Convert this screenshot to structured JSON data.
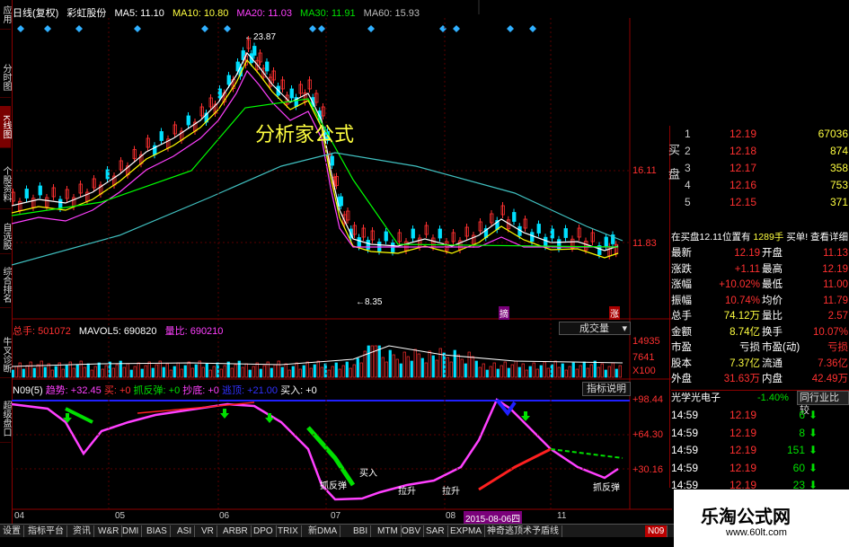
{
  "colors": {
    "up": "#ff3030",
    "down": "#00e0ff",
    "ma5": "#ffffff",
    "ma10": "#ffff00",
    "ma20": "#ff40ff",
    "ma30": "#00ff00",
    "ma60": "#c0c0c0",
    "trend_line": "#ff40ff",
    "blue_line": "#2020ff"
  },
  "sidebar": {
    "tabs": [
      "应用",
      "分时图",
      "K线图",
      "个股资料",
      "自选股",
      "综合排名",
      "牛叉诊断",
      "超级盘口"
    ]
  },
  "header": {
    "period": "日线(复权)",
    "stock_name": "彩虹股份",
    "ma5": "MA5: 11.10",
    "ma10": "MA10: 10.80",
    "ma20": "MA20: 11.03",
    "ma30": "MA30: 11.91",
    "ma60": "MA60: 15.93"
  },
  "price_chart": {
    "high_label": "23.87",
    "low_label": "8.35",
    "watermark": "分析家公式",
    "price_axis": [
      "16.11",
      "11.83"
    ],
    "tag_buy": "摘",
    "tag_sell": "涨"
  },
  "volume_panel": {
    "total": "总手: 501072",
    "mavol": "MAVOL5: 690820",
    "ratio": "量比: 690210",
    "mode": "成交量",
    "axis": [
      "14935",
      "7641",
      "X100"
    ]
  },
  "indicator_panel": {
    "name": "N09(5)",
    "trend": "趋势: +32.45",
    "buy1": "买: +0",
    "rebound": "抓反弹: +0",
    "bottom": "抄底: +0",
    "peak": "逃顶: +21.00",
    "buy2": "买入: +0",
    "help": "指标说明",
    "axis": [
      "+98.44",
      "+64.30",
      "+30.16"
    ],
    "labels": [
      "抓反弹",
      "买入",
      "拉升",
      "拉升",
      "抓反弹"
    ]
  },
  "x_axis": {
    "labels": [
      "04",
      "05",
      "06",
      "07",
      "08",
      "11"
    ],
    "date_highlight": "2015-08-06四"
  },
  "orderbook": {
    "side_label": "买盘",
    "rows": [
      {
        "level": "1",
        "price": "12.19",
        "vol": "67036"
      },
      {
        "level": "2",
        "price": "12.18",
        "vol": "874"
      },
      {
        "level": "3",
        "price": "12.17",
        "vol": "358"
      },
      {
        "level": "4",
        "price": "12.16",
        "vol": "753"
      },
      {
        "level": "5",
        "price": "12.15",
        "vol": "371"
      }
    ],
    "notice": "在买盘12.11位置有",
    "notice_vol": "1289手",
    "notice_link": "买单! 查看详细"
  },
  "stats": [
    {
      "l1": "最新",
      "v1": "12.19",
      "l2": "开盘",
      "v2": "11.13"
    },
    {
      "l1": "涨跌",
      "v1": "+1.11",
      "l2": "最高",
      "v2": "12.19"
    },
    {
      "l1": "涨幅",
      "v1": "+10.02%",
      "l2": "最低",
      "v2": "11.00"
    },
    {
      "l1": "振幅",
      "v1": "10.74%",
      "l2": "均价",
      "v2": "11.79"
    },
    {
      "l1": "总手",
      "v1": "74.12万",
      "l2": "量比",
      "v2": "2.57"
    },
    {
      "l1": "金额",
      "v1": "8.74亿",
      "l2": "换手",
      "v2": "10.07%"
    },
    {
      "l1": "市盈",
      "v1": "亏损",
      "l2": "市盈(动)",
      "v2": "亏损"
    },
    {
      "l1": "股本",
      "v1": "7.37亿",
      "l2": "流通",
      "v2": "7.36亿"
    },
    {
      "l1": "外盘",
      "v1": "31.63万",
      "l2": "内盘",
      "v2": "42.49万"
    }
  ],
  "sector": {
    "name": "光学光电子",
    "change": "-1.40%",
    "compare": "同行业比较"
  },
  "ticks": [
    {
      "time": "14:59",
      "price": "12.19",
      "vol": "6",
      "dir": "down"
    },
    {
      "time": "14:59",
      "price": "12.19",
      "vol": "8",
      "dir": "down"
    },
    {
      "time": "14:59",
      "price": "12.19",
      "vol": "151",
      "dir": "down"
    },
    {
      "time": "14:59",
      "price": "12.19",
      "vol": "60",
      "dir": "down"
    },
    {
      "time": "14:59",
      "price": "12.19",
      "vol": "23",
      "dir": "down"
    }
  ],
  "bottom_tabs": [
    "设置",
    "指标平台",
    "资讯",
    "W&R",
    "DMI",
    "BIAS",
    "ASI",
    "VR",
    "ARBR",
    "DPO",
    "TRIX",
    "新DMA",
    "BBI",
    "MTM",
    "OBV",
    "SAR",
    "EXPMA",
    "神奇逃顶术予盾线",
    "N09"
  ],
  "brand": {
    "name": "乐淘公式网",
    "url": "www.60lt.com"
  }
}
